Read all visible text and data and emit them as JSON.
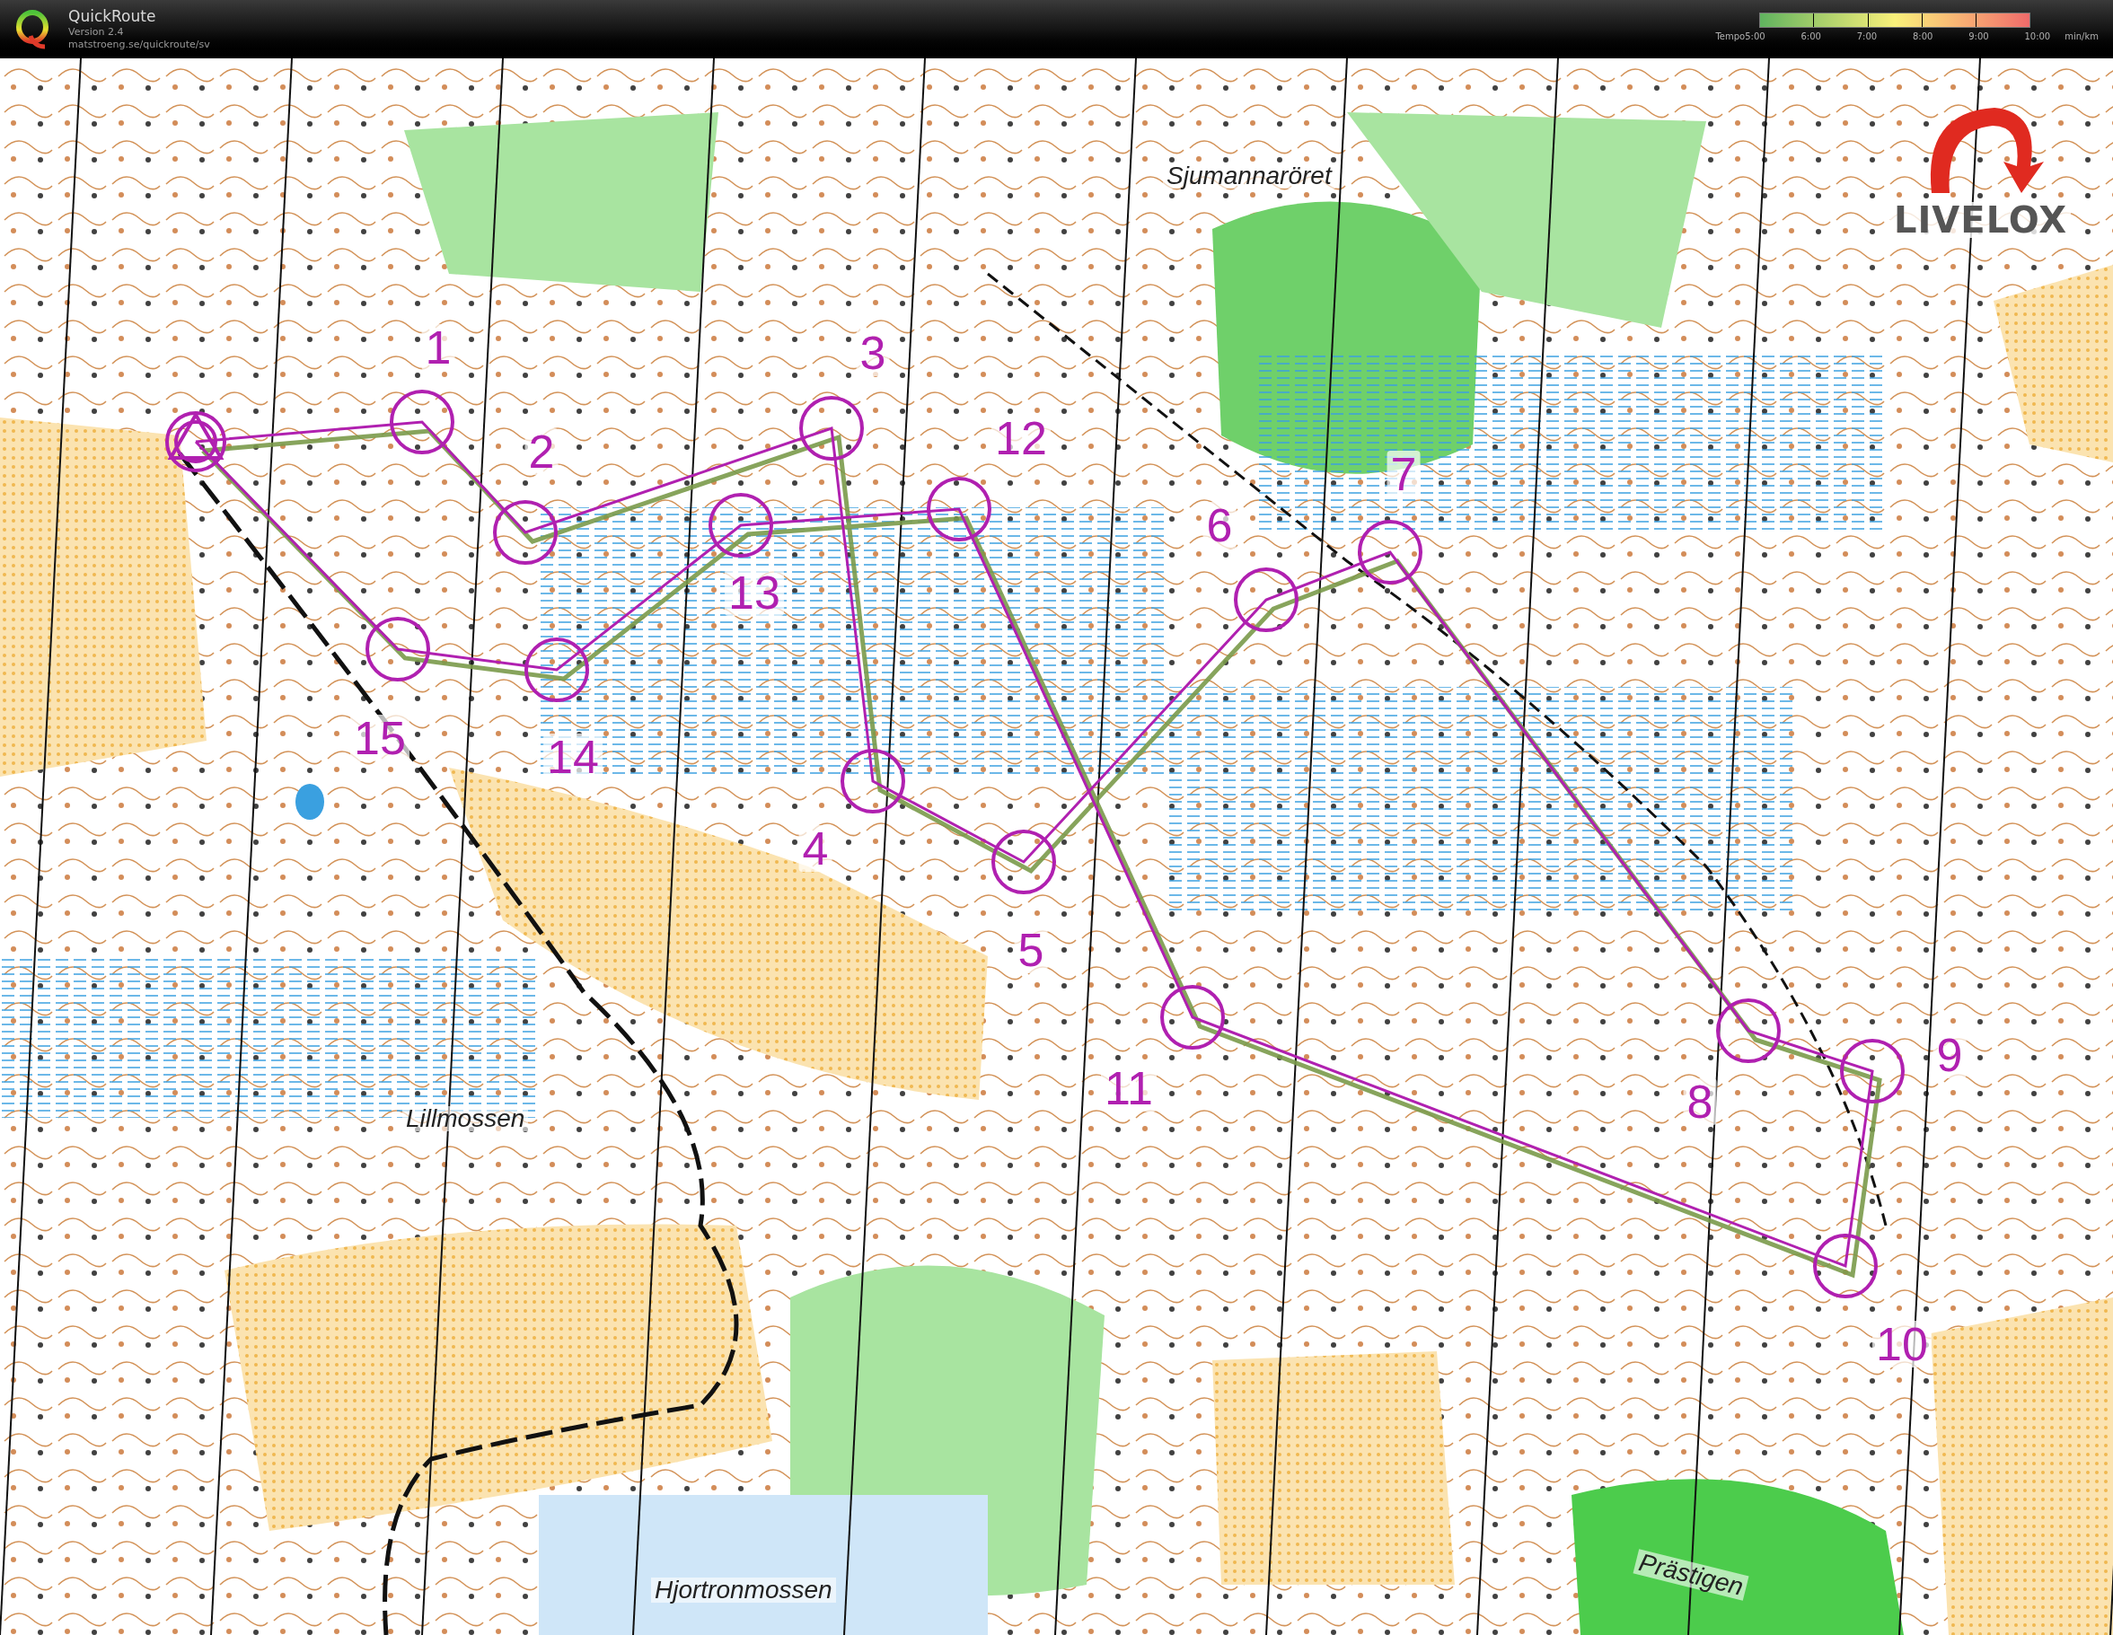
{
  "header": {
    "title": "QuickRoute",
    "version": "Version 2.4",
    "url": "matstroeng.se/quickroute/sv"
  },
  "legend": {
    "label": "Tempo",
    "ticks": [
      "5:00",
      "6:00",
      "7:00",
      "8:00",
      "9:00",
      "10:00"
    ],
    "unit": "min/km"
  },
  "map": {
    "logo": "LIVELOX",
    "place_names": [
      {
        "text": "Sjumannaröret"
      },
      {
        "text": "Lillmossen"
      },
      {
        "text": "Hjortronmossen"
      },
      {
        "text": "Prästigen"
      }
    ],
    "controls": [
      {
        "number": "1"
      },
      {
        "number": "2"
      },
      {
        "number": "3"
      },
      {
        "number": "4"
      },
      {
        "number": "5"
      },
      {
        "number": "6"
      },
      {
        "number": "7"
      },
      {
        "number": "8"
      },
      {
        "number": "9"
      },
      {
        "number": "10"
      },
      {
        "number": "11"
      },
      {
        "number": "12"
      },
      {
        "number": "13"
      },
      {
        "number": "14"
      },
      {
        "number": "15"
      }
    ]
  }
}
